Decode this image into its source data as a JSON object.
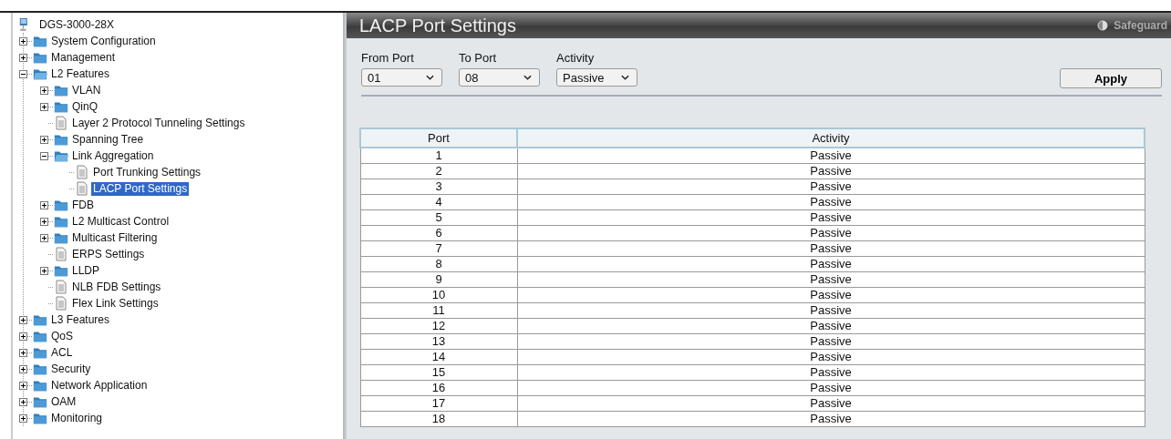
{
  "tree": {
    "root": "DGS-3000-28X",
    "items": [
      {
        "label": "System Configuration",
        "kind": "folder",
        "expanded": false,
        "selected": false
      },
      {
        "label": "Management",
        "kind": "folder",
        "expanded": false,
        "selected": false
      },
      {
        "label": "L2 Features",
        "kind": "folder",
        "expanded": true,
        "selected": false,
        "children": [
          {
            "label": "VLAN",
            "kind": "folder",
            "expanded": false,
            "selected": false
          },
          {
            "label": "QinQ",
            "kind": "folder",
            "expanded": false,
            "selected": false
          },
          {
            "label": "Layer 2 Protocol Tunneling Settings",
            "kind": "page",
            "selected": false
          },
          {
            "label": "Spanning Tree",
            "kind": "folder",
            "expanded": false,
            "selected": false
          },
          {
            "label": "Link Aggregation",
            "kind": "folder",
            "expanded": true,
            "selected": false,
            "children": [
              {
                "label": "Port Trunking Settings",
                "kind": "page",
                "selected": false
              },
              {
                "label": "LACP Port Settings",
                "kind": "page",
                "selected": true
              }
            ]
          },
          {
            "label": "FDB",
            "kind": "folder",
            "expanded": false,
            "selected": false
          },
          {
            "label": "L2 Multicast Control",
            "kind": "folder",
            "expanded": false,
            "selected": false
          },
          {
            "label": "Multicast Filtering",
            "kind": "folder",
            "expanded": false,
            "selected": false
          },
          {
            "label": "ERPS Settings",
            "kind": "page",
            "selected": false
          },
          {
            "label": "LLDP",
            "kind": "folder",
            "expanded": false,
            "selected": false
          },
          {
            "label": "NLB FDB Settings",
            "kind": "page",
            "selected": false
          },
          {
            "label": "Flex Link Settings",
            "kind": "page",
            "selected": false
          }
        ]
      },
      {
        "label": "L3 Features",
        "kind": "folder",
        "expanded": false,
        "selected": false
      },
      {
        "label": "QoS",
        "kind": "folder",
        "expanded": false,
        "selected": false
      },
      {
        "label": "ACL",
        "kind": "folder",
        "expanded": false,
        "selected": false
      },
      {
        "label": "Security",
        "kind": "folder",
        "expanded": false,
        "selected": false
      },
      {
        "label": "Network Application",
        "kind": "folder",
        "expanded": false,
        "selected": false
      },
      {
        "label": "OAM",
        "kind": "folder",
        "expanded": false,
        "selected": false
      },
      {
        "label": "Monitoring",
        "kind": "folder",
        "expanded": false,
        "selected": false
      }
    ]
  },
  "page": {
    "title": "LACP Port Settings",
    "safeguard": "Safeguard",
    "fields": [
      {
        "label": "From Port",
        "value": "01"
      },
      {
        "label": "To Port",
        "value": "08"
      },
      {
        "label": "Activity",
        "value": "Passive"
      }
    ],
    "apply": "Apply",
    "table": {
      "columns": [
        "Port",
        "Activity"
      ],
      "rows": [
        [
          "1",
          "Passive"
        ],
        [
          "2",
          "Passive"
        ],
        [
          "3",
          "Passive"
        ],
        [
          "4",
          "Passive"
        ],
        [
          "5",
          "Passive"
        ],
        [
          "6",
          "Passive"
        ],
        [
          "7",
          "Passive"
        ],
        [
          "8",
          "Passive"
        ],
        [
          "9",
          "Passive"
        ],
        [
          "10",
          "Passive"
        ],
        [
          "11",
          "Passive"
        ],
        [
          "12",
          "Passive"
        ],
        [
          "13",
          "Passive"
        ],
        [
          "14",
          "Passive"
        ],
        [
          "15",
          "Passive"
        ],
        [
          "16",
          "Passive"
        ],
        [
          "17",
          "Passive"
        ],
        [
          "18",
          "Passive"
        ]
      ]
    }
  }
}
